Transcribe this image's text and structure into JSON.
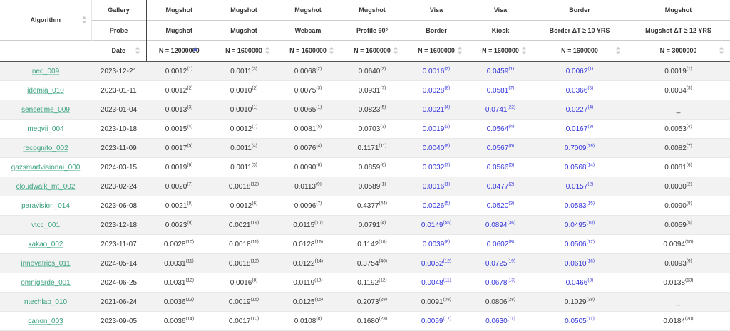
{
  "header": {
    "algorithm_label": "Algorithm",
    "row_labels": {
      "gallery": "Gallery",
      "probe": "Probe",
      "date": "Date"
    },
    "columns": [
      {
        "gallery": "Mugshot",
        "probe": "Mugshot",
        "n": "N = 12000000",
        "sorted": true
      },
      {
        "gallery": "Mugshot",
        "probe": "Mugshot",
        "n": "N = 1600000"
      },
      {
        "gallery": "Mugshot",
        "probe": "Webcam",
        "n": "N = 1600000"
      },
      {
        "gallery": "Mugshot",
        "probe": "Profile 90°",
        "n": "N = 1600000"
      },
      {
        "gallery": "Visa",
        "probe": "Border",
        "n": "N = 1600000"
      },
      {
        "gallery": "Visa",
        "probe": "Kiosk",
        "n": "N = 1600000"
      },
      {
        "gallery": "Border",
        "probe": "Border ΔT ≥ 10 YRS",
        "n": "N = 1600000"
      },
      {
        "gallery": "Mugshot",
        "probe": "Mugshot ΔT ≥ 12 YRS",
        "n": "N = 3000000"
      }
    ]
  },
  "colors": {
    "link": "#3aa17e",
    "blue_value": "#3333dd",
    "sort_active": "#4b5cc4"
  },
  "rows": [
    {
      "name": "nec_009",
      "date": "2023-12-21",
      "cells": [
        [
          "0.0012",
          "1"
        ],
        [
          "0.0011",
          "3"
        ],
        [
          "0.0068",
          "2"
        ],
        [
          "0.0640",
          "2"
        ],
        [
          "0.0016",
          "2"
        ],
        [
          "0.0459",
          "1"
        ],
        [
          "0.0062",
          "1"
        ],
        [
          "0.0019",
          "1"
        ]
      ]
    },
    {
      "name": "idemia_010",
      "date": "2023-01-11",
      "cells": [
        [
          "0.0012",
          "2"
        ],
        [
          "0.0010",
          "2"
        ],
        [
          "0.0075",
          "3"
        ],
        [
          "0.0931",
          "7"
        ],
        [
          "0.0028",
          "6"
        ],
        [
          "0.0581",
          "7"
        ],
        [
          "0.0366",
          "5"
        ],
        [
          "0.0034",
          "3"
        ]
      ]
    },
    {
      "name": "sensetime_009",
      "date": "2023-01-04",
      "cells": [
        [
          "0.0013",
          "3"
        ],
        [
          "0.0010",
          "1"
        ],
        [
          "0.0065",
          "1"
        ],
        [
          "0.0823",
          "5"
        ],
        [
          "0.0021",
          "4"
        ],
        [
          "0.0741",
          "22"
        ],
        [
          "0.0227",
          "4"
        ],
        [
          "_",
          ""
        ]
      ]
    },
    {
      "name": "megvii_004",
      "date": "2023-10-18",
      "cells": [
        [
          "0.0015",
          "4"
        ],
        [
          "0.0012",
          "7"
        ],
        [
          "0.0081",
          "5"
        ],
        [
          "0.0703",
          "3"
        ],
        [
          "0.0019",
          "3"
        ],
        [
          "0.0564",
          "4"
        ],
        [
          "0.0167",
          "3"
        ],
        [
          "0.0053",
          "4"
        ]
      ]
    },
    {
      "name": "recognito_002",
      "date": "2023-11-09",
      "cells": [
        [
          "0.0017",
          "5"
        ],
        [
          "0.0011",
          "4"
        ],
        [
          "0.0076",
          "4"
        ],
        [
          "0.1171",
          "11"
        ],
        [
          "0.0040",
          "9"
        ],
        [
          "0.0567",
          "6"
        ],
        [
          "0.7009",
          "79"
        ],
        [
          "0.0082",
          "7"
        ]
      ]
    },
    {
      "name": "qazsmartvisionai_000",
      "date": "2024-03-15",
      "cells": [
        [
          "0.0019",
          "6"
        ],
        [
          "0.0011",
          "5"
        ],
        [
          "0.0090",
          "6"
        ],
        [
          "0.0859",
          "6"
        ],
        [
          "0.0032",
          "7"
        ],
        [
          "0.0566",
          "5"
        ],
        [
          "0.0568",
          "14"
        ],
        [
          "0.0081",
          "6"
        ]
      ]
    },
    {
      "name": "cloudwalk_mt_002",
      "date": "2023-02-24",
      "cells": [
        [
          "0.0020",
          "7"
        ],
        [
          "0.0018",
          "12"
        ],
        [
          "0.0113",
          "9"
        ],
        [
          "0.0589",
          "1"
        ],
        [
          "0.0016",
          "1"
        ],
        [
          "0.0477",
          "2"
        ],
        [
          "0.0157",
          "2"
        ],
        [
          "0.0030",
          "2"
        ]
      ]
    },
    {
      "name": "paravision_014",
      "date": "2023-06-08",
      "cells": [
        [
          "0.0021",
          "8"
        ],
        [
          "0.0012",
          "6"
        ],
        [
          "0.0096",
          "7"
        ],
        [
          "0.4377",
          "44"
        ],
        [
          "0.0026",
          "5"
        ],
        [
          "0.0520",
          "3"
        ],
        [
          "0.0583",
          "15"
        ],
        [
          "0.0090",
          "8"
        ]
      ]
    },
    {
      "name": "vtcc_001",
      "date": "2023-12-18",
      "cells": [
        [
          "0.0023",
          "9"
        ],
        [
          "0.0021",
          "19"
        ],
        [
          "0.0115",
          "10"
        ],
        [
          "0.0791",
          "4"
        ],
        [
          "0.0149",
          "55"
        ],
        [
          "0.0894",
          "36"
        ],
        [
          "0.0495",
          "10"
        ],
        [
          "0.0059",
          "5"
        ]
      ]
    },
    {
      "name": "kakao_002",
      "date": "2023-11-07",
      "cells": [
        [
          "0.0028",
          "10"
        ],
        [
          "0.0018",
          "11"
        ],
        [
          "0.0128",
          "16"
        ],
        [
          "0.1142",
          "10"
        ],
        [
          "0.0039",
          "8"
        ],
        [
          "0.0602",
          "8"
        ],
        [
          "0.0506",
          "12"
        ],
        [
          "0.0094",
          "10"
        ]
      ]
    },
    {
      "name": "innovatrics_011",
      "date": "2024-05-14",
      "cells": [
        [
          "0.0031",
          "11"
        ],
        [
          "0.0018",
          "13"
        ],
        [
          "0.0122",
          "14"
        ],
        [
          "0.3754",
          "40"
        ],
        [
          "0.0052",
          "12"
        ],
        [
          "0.0725",
          "19"
        ],
        [
          "0.0610",
          "16"
        ],
        [
          "0.0093",
          "9"
        ]
      ]
    },
    {
      "name": "omnigarde_001",
      "date": "2024-06-25",
      "cells": [
        [
          "0.0031",
          "12"
        ],
        [
          "0.0016",
          "8"
        ],
        [
          "0.0119",
          "13"
        ],
        [
          "0.1192",
          "12"
        ],
        [
          "0.0048",
          "11"
        ],
        [
          "0.0678",
          "13"
        ],
        [
          "0.0466",
          "8"
        ],
        [
          "0.0138",
          "13"
        ]
      ]
    },
    {
      "name": "ntechlab_010",
      "date": "2021-06-24",
      "cells": [
        [
          "0.0036",
          "13"
        ],
        [
          "0.0019",
          "16"
        ],
        [
          "0.0125",
          "15"
        ],
        [
          "0.2073",
          "28"
        ],
        [
          "0.0091",
          "38"
        ],
        [
          "0.0806",
          "28"
        ],
        [
          "0.1029",
          "38"
        ],
        [
          "_",
          ""
        ]
      ]
    },
    {
      "name": "canon_003",
      "date": "2023-09-05",
      "cells": [
        [
          "0.0036",
          "14"
        ],
        [
          "0.0017",
          "10"
        ],
        [
          "0.0108",
          "8"
        ],
        [
          "0.1680",
          "23"
        ],
        [
          "0.0059",
          "17"
        ],
        [
          "0.0630",
          "11"
        ],
        [
          "0.0505",
          "11"
        ],
        [
          "0.0184",
          "20"
        ]
      ]
    }
  ],
  "blue_columns": [
    4,
    5,
    6
  ],
  "black_rows_in_blue_columns": [
    12
  ]
}
